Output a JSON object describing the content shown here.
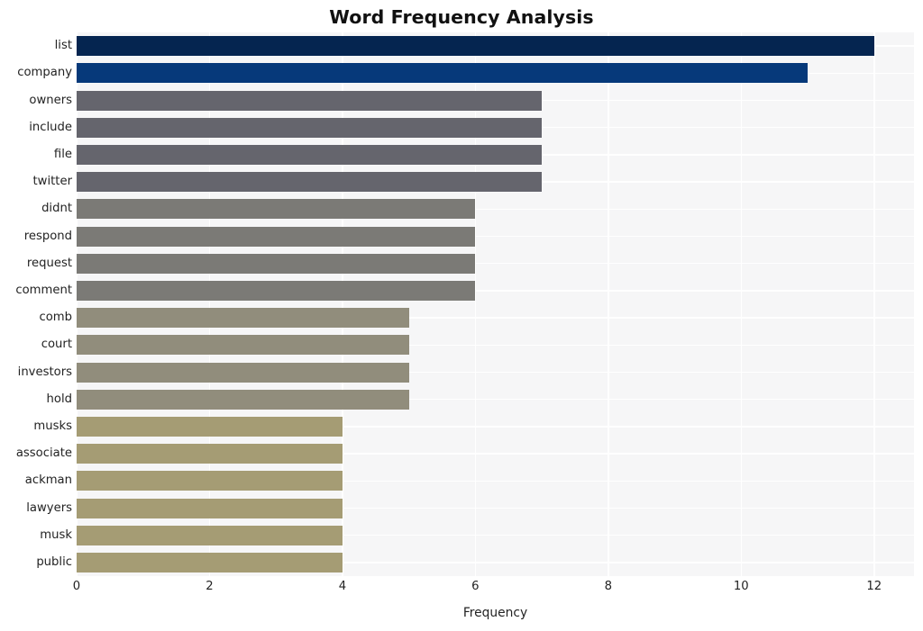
{
  "chart_data": {
    "type": "bar",
    "orientation": "horizontal",
    "title": "Word Frequency Analysis",
    "xlabel": "Frequency",
    "ylabel": "",
    "xlim": [
      0,
      12.6
    ],
    "ylim": [
      0,
      20
    ],
    "grid": true,
    "legend": null,
    "xticks": [
      0,
      2,
      4,
      6,
      8,
      10,
      12
    ],
    "xtick_labels": [
      "0",
      "2",
      "4",
      "6",
      "8",
      "10",
      "12"
    ],
    "categories": [
      "list",
      "company",
      "owners",
      "include",
      "file",
      "twitter",
      "didnt",
      "respond",
      "request",
      "comment",
      "comb",
      "court",
      "investors",
      "hold",
      "musks",
      "associate",
      "ackman",
      "lawyers",
      "musk",
      "public"
    ],
    "values": [
      12,
      11,
      7,
      7,
      7,
      7,
      6,
      6,
      6,
      6,
      5,
      5,
      5,
      5,
      4,
      4,
      4,
      4,
      4,
      4
    ],
    "bar_colors": [
      "#052550",
      "#06397a",
      "#65656d",
      "#65656d",
      "#65656d",
      "#65656d",
      "#7b7a76",
      "#7b7a76",
      "#7b7a76",
      "#7b7a76",
      "#918d7c",
      "#918d7c",
      "#918d7c",
      "#918d7c",
      "#a59c74",
      "#a59c74",
      "#a59c74",
      "#a59c74",
      "#a59c74",
      "#a59c74"
    ],
    "plot_background": "#f6f6f7",
    "grid_color": "#ffffff",
    "figure_background": "#ffffff",
    "text_color": "#232323"
  }
}
